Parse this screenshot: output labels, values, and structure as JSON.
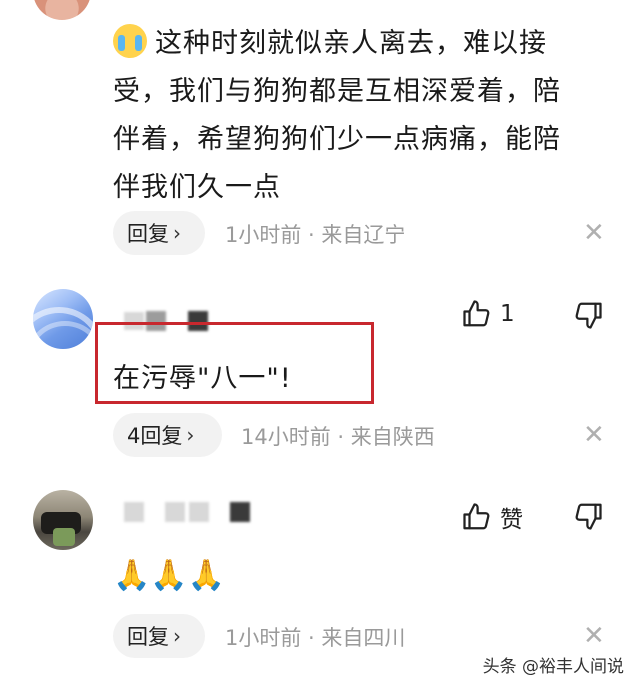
{
  "comments": [
    {
      "text_lines": [
        "这种时刻就似亲人离去，难以接",
        "受，我们与狗狗都是互相深爱着，陪",
        "伴着，希望狗狗们少一点病痛，能陪",
        "伴我们久一点"
      ],
      "emoji": "crying-face",
      "reply_label": "回复",
      "meta": "1小时前 · 来自辽宁"
    },
    {
      "text": "在污辱\"八一\"!",
      "reply_label": "4回复",
      "meta": "14小时前 · 来自陕西",
      "like_count": "1"
    },
    {
      "text": "🙏🙏🙏",
      "reply_label": "回复",
      "meta": "1小时前 · 来自四川",
      "like_label": "赞"
    }
  ],
  "icons": {
    "like": "thumbs-up-icon",
    "dislike": "thumbs-down-icon",
    "close": "close-icon",
    "chevron": "chevron-right-icon"
  },
  "colors": {
    "highlight": "#c8282e",
    "meta": "#9a9a9a",
    "pill_bg": "#f2f2f2"
  },
  "watermark": "头条 @裕丰人间说"
}
